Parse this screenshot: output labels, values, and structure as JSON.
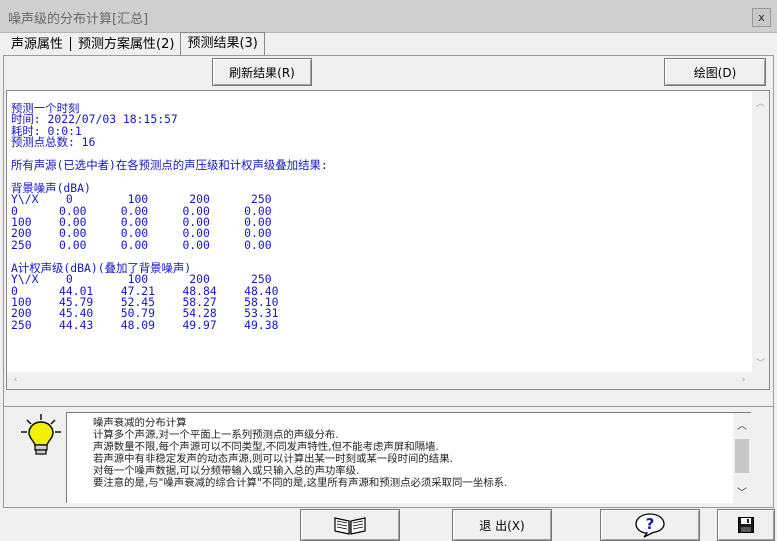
{
  "window": {
    "title": "噪声级的分布计算[汇总]",
    "close_symbol": "x"
  },
  "tabs": [
    {
      "label": "声源属性",
      "active": false
    },
    {
      "label": "预测方案属性(2)",
      "active": false
    },
    {
      "label": "预测结果(3)",
      "active": true
    }
  ],
  "toolbar": {
    "refresh_label": "刷新结果(R)",
    "draw_label": "绘图(D)"
  },
  "results_text": "预测一个时刻\n时间: 2022/07/03 18:15:57\n耗时: 0:0:1\n预测点总数: 16\n\n所有声源(已选中者)在各预测点的声压级和计权声级叠加结果:\n\n背景噪声(dBA)\nY\\/X    0        100      200      250\n0      0.00     0.00     0.00     0.00\n100    0.00     0.00     0.00     0.00\n200    0.00     0.00     0.00     0.00\n250    0.00     0.00     0.00     0.00\n\nA计权声级(dBA)(叠加了背景噪声)\nY\\/X    0        100      200      250\n0      44.01    47.21    48.84    48.40\n100    45.79    52.45    58.27    58.10\n200    45.40    50.79    54.28    53.31\n250    44.43    48.09    49.97    49.38",
  "help": {
    "text": "噪声衰减的分布计算\n计算多个声源,对一个平面上一系列预测点的声级分布.\n声源数量不限,每个声源可以不同类型,不同发声特性,但不能考虑声屏和隔墙.\n若声源中有非稳定发声的动态声源,则可以计算出某一时刻或某一段时间的结果.\n对每一个噪声数据,可以分频带输入或只输入总的声功率级.\n要注意的是,与\"噪声衰减的综合计算\"不同的是,这里所有声源和预测点必须采取同一坐标系."
  },
  "bottom": {
    "exit_label": "退 出(X)",
    "help_symbol": "?"
  },
  "colors": {
    "output_text": "#1515c8",
    "title_text": "#6a6a6a"
  },
  "icons": {
    "book": "book-icon",
    "help": "help-icon",
    "save": "save-icon",
    "bulb": "lightbulb-icon"
  }
}
